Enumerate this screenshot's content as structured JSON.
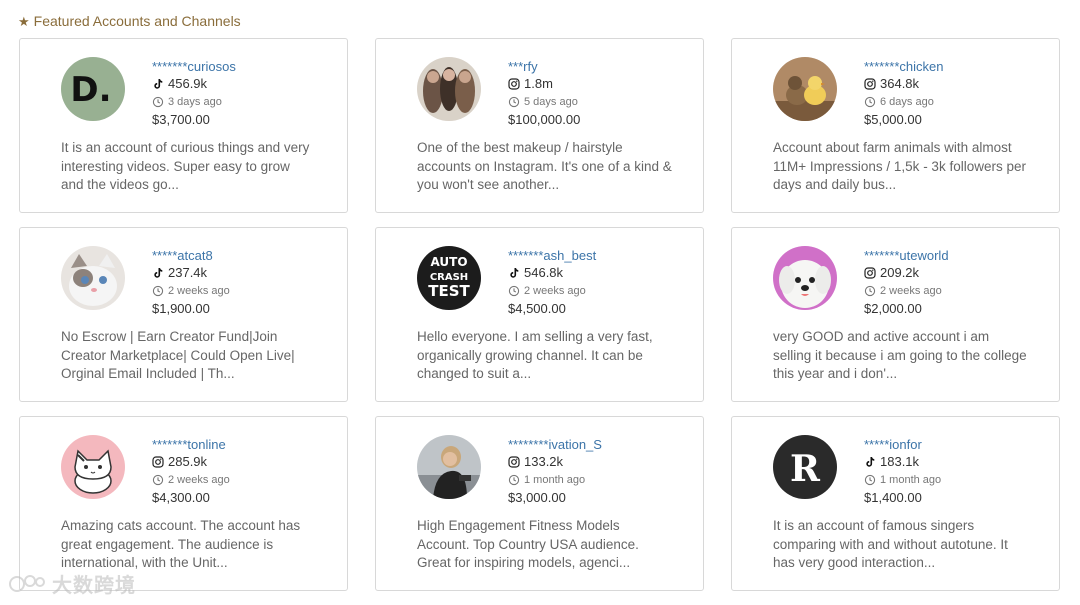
{
  "section": {
    "title": "Featured Accounts and Channels",
    "icon": "star-icon"
  },
  "cards": [
    {
      "handle": "*******curiosos",
      "platform": "tiktok",
      "followers": "456.9k",
      "ago": "3 days ago",
      "price": "$3,700.00",
      "desc": "It is an account of curious things and very interesting videos. Super easy to grow and the videos go...",
      "avatar_text": "D."
    },
    {
      "handle": "***rfy",
      "platform": "instagram",
      "followers": "1.8m",
      "ago": "5 days ago",
      "price": "$100,000.00",
      "desc": "One of the best makeup / hairstyle accounts on Instagram. It's one of a kind & you won't see another...",
      "avatar_text": ""
    },
    {
      "handle": "*******chicken",
      "platform": "instagram",
      "followers": "364.8k",
      "ago": "6 days ago",
      "price": "$5,000.00",
      "desc": "Account about farm animals with almost 11M+ Impressions / 1,5k - 3k followers per days and daily bus...",
      "avatar_text": ""
    },
    {
      "handle": "*****atcat8",
      "platform": "tiktok",
      "followers": "237.4k",
      "ago": "2 weeks ago",
      "price": "$1,900.00",
      "desc": "No Escrow | Earn Creator Fund|Join Creator Marketplace| Could Open Live| Orginal Email Included | Th...",
      "avatar_text": ""
    },
    {
      "handle": "*******ash_best",
      "platform": "tiktok",
      "followers": "546.8k",
      "ago": "2 weeks ago",
      "price": "$4,500.00",
      "desc": "Hello everyone. I am selling a very fast, organically growing channel. It can be changed to suit a...",
      "avatar_text": "AUTO CRASH TEST"
    },
    {
      "handle": "*******uteworld",
      "platform": "instagram",
      "followers": "209.2k",
      "ago": "2 weeks ago",
      "price": "$2,000.00",
      "desc": "very GOOD and active account i am selling it because i am going to the college this year and i don'...",
      "avatar_text": ""
    },
    {
      "handle": "*******tonline",
      "platform": "instagram",
      "followers": "285.9k",
      "ago": "2 weeks ago",
      "price": "$4,300.00",
      "desc": "Amazing cats account. The account has great engagement. The audience is international, with the Unit...",
      "avatar_text": ""
    },
    {
      "handle": "********ivation_S",
      "platform": "instagram",
      "followers": "133.2k",
      "ago": "1 month ago",
      "price": "$3,000.00",
      "desc": "High Engagement Fitness Models Account. Top Country USA audience. Great for inspiring models, agenci...",
      "avatar_text": ""
    },
    {
      "handle": "*****ionfor",
      "platform": "tiktok",
      "followers": "183.1k",
      "ago": "1 month ago",
      "price": "$1,400.00",
      "desc": "It is an account of famous singers comparing with and without autotune. It has very good interaction...",
      "avatar_text": "R"
    }
  ],
  "watermark": {
    "text": "大数跨境"
  },
  "colors": {
    "accent": "#3c74a8",
    "header": "#8a6d3b",
    "border": "#d8d8d8"
  }
}
